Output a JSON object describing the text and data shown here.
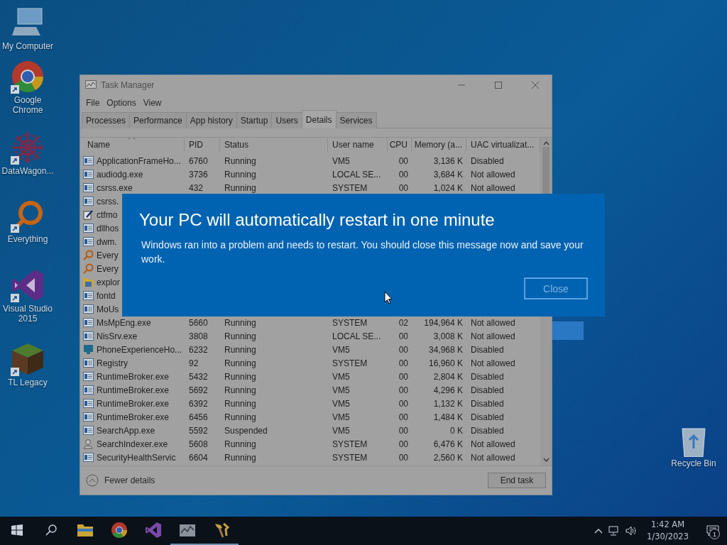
{
  "desktop_icons": [
    {
      "label": "My Computer",
      "kind": "computer",
      "shortcut": false
    },
    {
      "label": "Google Chrome",
      "kind": "chrome",
      "shortcut": true
    },
    {
      "label": "DataWagon...",
      "kind": "wagon",
      "shortcut": true
    },
    {
      "label": "Everything",
      "kind": "everything",
      "shortcut": true
    },
    {
      "label": "Visual Studio 2015",
      "kind": "vs",
      "shortcut": true
    },
    {
      "label": "TL Legacy",
      "kind": "block",
      "shortcut": true
    }
  ],
  "recycle_bin": {
    "label": "Recycle Bin"
  },
  "task_manager": {
    "title": "Task Manager",
    "menu": [
      "File",
      "Options",
      "View"
    ],
    "tabs": [
      {
        "label": "Processes",
        "selected": false
      },
      {
        "label": "Performance",
        "selected": false
      },
      {
        "label": "App history",
        "selected": false
      },
      {
        "label": "Startup",
        "selected": false
      },
      {
        "label": "Users",
        "selected": false
      },
      {
        "label": "Details",
        "selected": true
      },
      {
        "label": "Services",
        "selected": false
      }
    ],
    "columns": [
      "Name",
      "PID",
      "Status",
      "User name",
      "CPU",
      "Memory (a...",
      "UAC virtualizat..."
    ],
    "rows": [
      {
        "kind": "app",
        "name": "ApplicationFrameHo...",
        "pid": "6760",
        "status": "Running",
        "user": "VM5",
        "cpu": "00",
        "memory": "3,136 K",
        "uac": "Disabled"
      },
      {
        "kind": "app",
        "name": "audiodg.exe",
        "pid": "3736",
        "status": "Running",
        "user": "LOCAL SE...",
        "cpu": "00",
        "memory": "3,684 K",
        "uac": "Not allowed"
      },
      {
        "kind": "app",
        "name": "csrss.exe",
        "pid": "432",
        "status": "Running",
        "user": "SYSTEM",
        "cpu": "00",
        "memory": "1,024 K",
        "uac": "Not allowed"
      },
      {
        "kind": "app",
        "name": "csrss."
      },
      {
        "kind": "pen",
        "name": "ctfmo"
      },
      {
        "kind": "app",
        "name": "dllhos"
      },
      {
        "kind": "app",
        "name": "dwm."
      },
      {
        "kind": "magnifier",
        "name": "Every"
      },
      {
        "kind": "magnifier",
        "name": "Every"
      },
      {
        "kind": "folder",
        "name": "explor"
      },
      {
        "kind": "app",
        "name": "fontd"
      },
      {
        "kind": "app",
        "name": "MoUs"
      },
      {
        "kind": "app",
        "name": "MsMpEng.exe",
        "pid": "5660",
        "status": "Running",
        "user": "SYSTEM",
        "cpu": "02",
        "memory": "194,964 K",
        "uac": "Not allowed"
      },
      {
        "kind": "app",
        "name": "NisSrv.exe",
        "pid": "3808",
        "status": "Running",
        "user": "LOCAL SE...",
        "cpu": "00",
        "memory": "3,008 K",
        "uac": "Not allowed"
      },
      {
        "kind": "monitor",
        "name": "PhoneExperienceHo...",
        "pid": "6232",
        "status": "Running",
        "user": "VM5",
        "cpu": "00",
        "memory": "34,968 K",
        "uac": "Disabled"
      },
      {
        "kind": "app",
        "name": "Registry",
        "pid": "92",
        "status": "Running",
        "user": "SYSTEM",
        "cpu": "00",
        "memory": "16,960 K",
        "uac": "Not allowed"
      },
      {
        "kind": "app",
        "name": "RuntimeBroker.exe",
        "pid": "5432",
        "status": "Running",
        "user": "VM5",
        "cpu": "00",
        "memory": "2,804 K",
        "uac": "Disabled"
      },
      {
        "kind": "app",
        "name": "RuntimeBroker.exe",
        "pid": "5692",
        "status": "Running",
        "user": "VM5",
        "cpu": "00",
        "memory": "4,296 K",
        "uac": "Disabled"
      },
      {
        "kind": "app",
        "name": "RuntimeBroker.exe",
        "pid": "6392",
        "status": "Running",
        "user": "VM5",
        "cpu": "00",
        "memory": "1,132 K",
        "uac": "Disabled"
      },
      {
        "kind": "app",
        "name": "RuntimeBroker.exe",
        "pid": "6456",
        "status": "Running",
        "user": "VM5",
        "cpu": "00",
        "memory": "1,484 K",
        "uac": "Disabled"
      },
      {
        "kind": "app",
        "name": "SearchApp.exe",
        "pid": "5592",
        "status": "Suspended",
        "user": "VM5",
        "cpu": "00",
        "memory": "0 K",
        "uac": "Disabled"
      },
      {
        "kind": "person",
        "name": "SearchIndexer.exe",
        "pid": "5608",
        "status": "Running",
        "user": "SYSTEM",
        "cpu": "00",
        "memory": "6,476 K",
        "uac": "Not allowed"
      },
      {
        "kind": "app",
        "name": "SecurityHealthServic",
        "pid": "6604",
        "status": "Running",
        "user": "SYSTEM",
        "cpu": "00",
        "memory": "2,560 K",
        "uac": "Not allowed"
      }
    ],
    "fewer_details": "Fewer details",
    "end_task": "End task"
  },
  "dialog": {
    "title": "Your PC will automatically restart in one minute",
    "message": "Windows ran into a problem and needs to restart. You should close this message now and save your work.",
    "button": "Close"
  },
  "taskbar": {
    "apps": [
      {
        "kind": "explorer",
        "running": false
      },
      {
        "kind": "chrome",
        "running": false
      },
      {
        "kind": "vs",
        "running": false
      },
      {
        "kind": "taskmgr",
        "running": true
      },
      {
        "kind": "tools",
        "running": true
      }
    ],
    "time": "1:42 AM",
    "date": "1/30/2023",
    "notifications": "1"
  }
}
